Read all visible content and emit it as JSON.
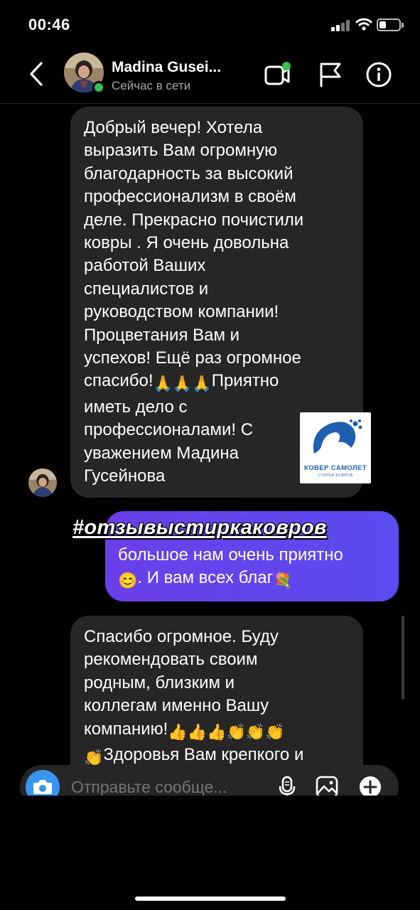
{
  "status_bar": {
    "time": "00:46"
  },
  "header": {
    "contact_name": "Madina Gusei...",
    "contact_status": "Сейчас в сети",
    "icons": [
      "back-chevron-icon",
      "video-call-icon",
      "flag-icon",
      "info-icon"
    ]
  },
  "messages": [
    {
      "side": "incoming",
      "text": "Добрый вечер! Хотела\nвыразить Вам огромную\nблагодарность за высокий\nпрофессионализм в своём\nделе. Прекрасно почистили\nковры . Я очень довольна\nработой Ваших\nспециалистов и\nруководством компании!\nПроцветания Вам и\nуспехов! Ещё раз огромное\nспасибо!",
      "emoji": "🙏🙏🙏",
      "text_after": "Приятно\nиметь дело с\nпрофессионалами! С\nуважением Мадина\nГусейнова"
    },
    {
      "side": "outgoing",
      "text": "большое нам очень приятно",
      "line2_emoji": "😊",
      "line2_text": ". И вам всех благ",
      "line2_end_emoji": "💐"
    },
    {
      "side": "incoming",
      "text": "Спасибо огромное. Буду\nрекомендовать своим\nродным, близким и\nколлегам именно Вашу\nкомпанию!",
      "emoji_row": "👍👍👍👏👏👏",
      "last_line_emoji": "👏",
      "last_line_text": "Здоровья Вам крепкого и"
    }
  ],
  "sticker": {
    "logo_title": "КОВЕР САМОЛЕТ",
    "logo_subtitle": "СТИРКА КОВРОВ",
    "hashtag": "#отзывыстиркаковров"
  },
  "composer": {
    "placeholder": "Отправьте сообще...",
    "icons": [
      "camera-icon",
      "microphone-icon",
      "gallery-icon",
      "plus-icon"
    ]
  },
  "colors": {
    "background": "#000000",
    "incoming_bubble": "#262626",
    "outgoing_bubble": "#5a4cf0",
    "online": "#37c24a",
    "camera_button": "#3797f0"
  }
}
